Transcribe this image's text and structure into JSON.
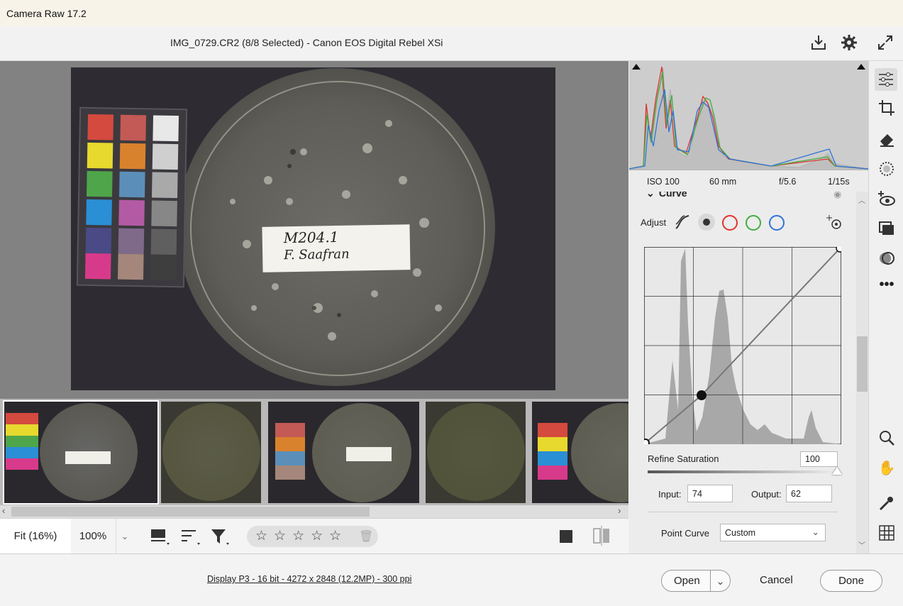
{
  "window": {
    "title": "Camera Raw 17.2"
  },
  "header": {
    "file_info": "IMG_0729.CR2 (8/8 Selected)  -  Canon EOS Digital Rebel XSi"
  },
  "photo": {
    "label_line1": "M204.1",
    "label_line2": "F. Saafran"
  },
  "exif": {
    "iso": "ISO 100",
    "focal": "60 mm",
    "aperture": "f/5.6",
    "shutter": "1/15s"
  },
  "curve": {
    "section_title": "Curve",
    "adjust_label": "Adjust",
    "refine_label": "Refine Saturation",
    "refine_value": "100",
    "input_label": "Input:",
    "input_value": "74",
    "output_label": "Output:",
    "output_value": "62",
    "point_curve_label": "Point Curve",
    "point_curve_value": "Custom"
  },
  "bottom": {
    "fit_label": "Fit (16%)",
    "zoom_label": "100%"
  },
  "footer": {
    "info": "Display P3 - 16 bit - 4272 x 2848 (12.2MP) - 300 ppi",
    "open": "Open",
    "cancel": "Cancel",
    "done": "Done"
  },
  "colors": {
    "red_channel": "#e0332e",
    "green_channel": "#3fae3f",
    "blue_channel": "#2f73d9"
  }
}
